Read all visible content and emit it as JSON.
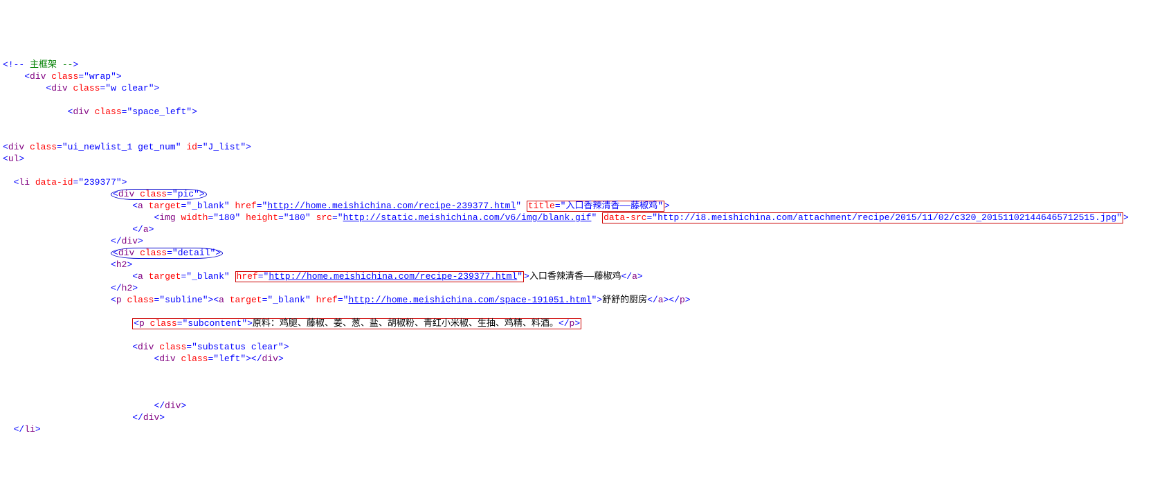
{
  "lines": {
    "l1_comment": " 主框架 --",
    "l2_div_wrap_class": "wrap",
    "l3_div_w_clear_class": "w clear",
    "l4_div_space_left_class": "space_left",
    "l5_div_ui_class": "ui_newlist_1 get_num",
    "l5_div_ui_id": "J_list",
    "l7_li_data_id": "239377",
    "l8_div_pic_class": "pic",
    "l9_a_target": "_blank",
    "l9_a_href": "http://home.meishichina.com/recipe-239377.html",
    "l9_a_title": "入口香辣清香——藤椒鸡",
    "l10_img_width": "180",
    "l10_img_height": "180",
    "l10_img_src": "http://static.meishichina.com/v6/img/blank.gif",
    "l10_img_datasrc": "http://i8.meishichina.com/attachment/recipe/2015/11/02/c320_201511021446465712515.jpg",
    "l13_div_detail_class": "detail",
    "l15_a_target": "_blank",
    "l15_a_href": "http://home.meishichina.com/recipe-239377.html",
    "l15_a_text": "入口香辣清香——藤椒鸡",
    "l17_p_subline_class": "subline",
    "l17_a_target": "_blank",
    "l17_a_href": "http://home.meishichina.com/space-191051.html",
    "l17_a_text": "舒舒的厨房",
    "l18_p_subcontent_class": "subcontent",
    "l18_p_text": "原料：鸡腿、藤椒、姜、葱、盐、胡椒粉、青红小米椒、生抽、鸡精、料酒。",
    "l19_div_substatus_class": "substatus clear",
    "l20_div_left_class": "left"
  }
}
